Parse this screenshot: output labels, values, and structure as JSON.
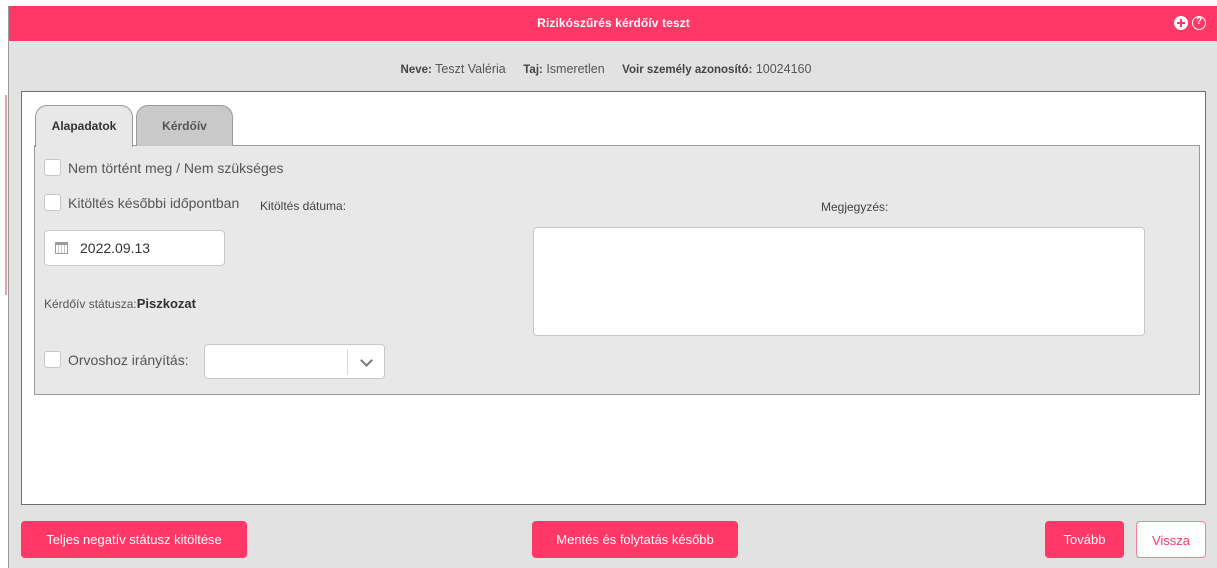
{
  "dialog": {
    "title": "Rizikószűrés kérdőív teszt",
    "icons": [
      "plus-circle-icon",
      "help-circle-icon"
    ],
    "help_glyph": "?"
  },
  "patient": {
    "name_label": "Neve:",
    "name_value": "Teszt Valéria",
    "taj_label": "Taj:",
    "taj_value": "Ismeretlen",
    "voir_label": "Voir személy azonosító:",
    "voir_value": "10024160"
  },
  "tabs": [
    {
      "label": "Alapadatok",
      "active": true
    },
    {
      "label": "Kérdőív",
      "active": false
    }
  ],
  "form": {
    "not_happened_label": "Nem történt meg / Nem szükséges",
    "later_label": "Kitöltés későbbi időpontban",
    "fill_date_label": "Kitöltés dátuma:",
    "fill_date_value": "2022.09.13",
    "status_label": "Kérdőív státusza:",
    "status_value": "Piszkozat",
    "doctor_referral_label": "Orvoshoz irányítás:",
    "doctor_referral_value": "",
    "notes_label": "Megjegyzés:",
    "notes_value": ""
  },
  "footer": {
    "full_negative_label": "Teljes negatív státusz kitöltése",
    "save_later_label": "Mentés és folytatás később",
    "next_label": "Tovább",
    "back_label": "Vissza"
  },
  "colors": {
    "accent": "#ff3868",
    "background": "#e2e2e2",
    "tab_content": "#e8e8e8"
  }
}
